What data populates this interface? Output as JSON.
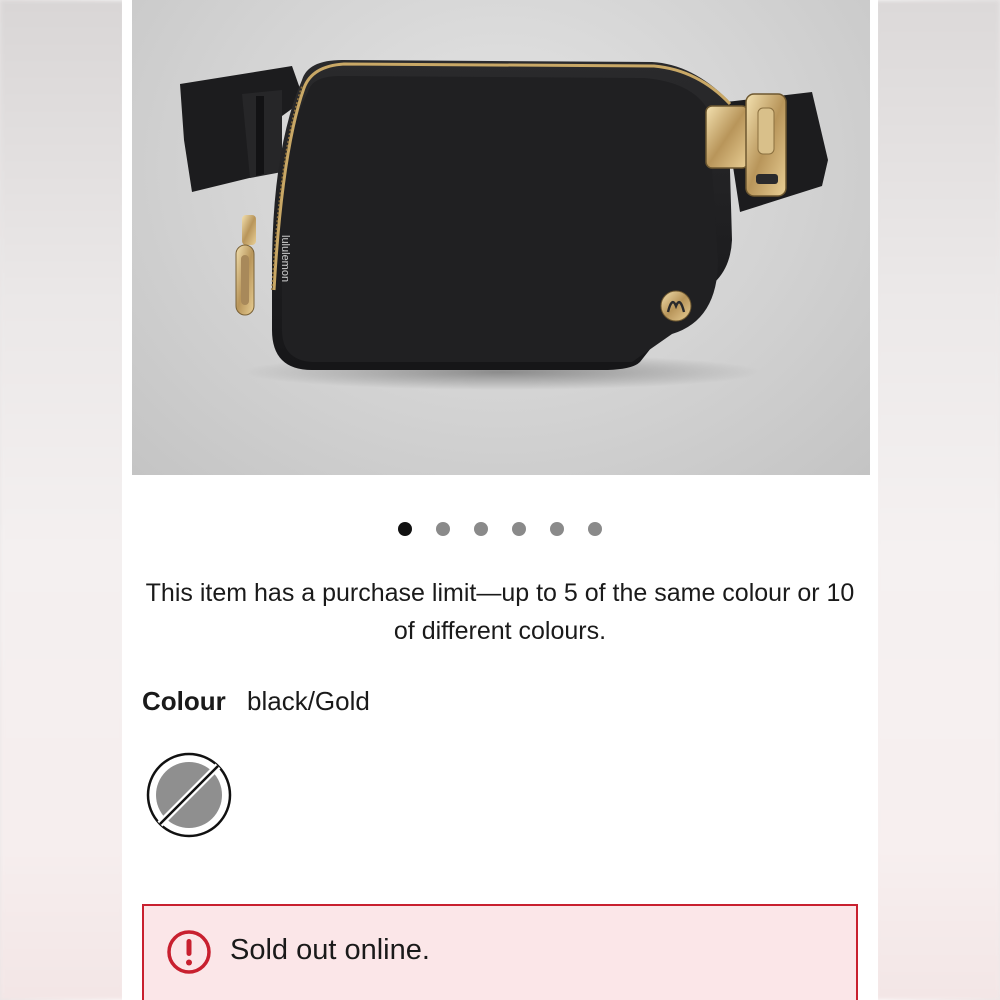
{
  "product": {
    "image_alt": "Black belt bag with gold zipper and buckle",
    "logo_text": "lululemon",
    "carousel": {
      "total": 6,
      "active_index": 0
    }
  },
  "purchase_limit_text": "This item has a purchase limit—up to 5 of the same colour or 10 of different colours.",
  "colour": {
    "label": "Colour",
    "value": "black/Gold",
    "swatch_state": "unavailable"
  },
  "alert": {
    "message": "Sold out online.",
    "color": "#c8202f",
    "background": "#fbe6e8",
    "icon": "exclamation-circle-icon"
  }
}
